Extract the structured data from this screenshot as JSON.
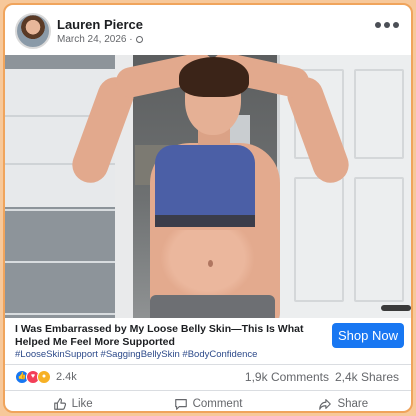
{
  "post": {
    "author_name": "Lauren Pierce",
    "date": "March 24, 2026",
    "date_separator": "·",
    "menu_icon": "more-horizontal-icon",
    "audience_icon": "globe-icon"
  },
  "ad": {
    "headline": "I Was Embarrassed by My Loose Belly Skin—This Is What Helped Me Feel More Supported",
    "hashtags": "#LooseSkinSupport #SaggingBellySkin #BodyConfidence",
    "cta_label": "Shop Now",
    "cta_color": "#1877f2"
  },
  "stats": {
    "reaction_icons": [
      "like-reaction-icon",
      "love-reaction-icon",
      "wow-reaction-icon"
    ],
    "reaction_count": "2.4k",
    "comments": "1,9k Comments",
    "shares": "2,4k Shares"
  },
  "actions": {
    "like": "Like",
    "comment": "Comment",
    "share": "Share"
  },
  "colors": {
    "frame_border": "#f0a45c",
    "background": "#f7c89a",
    "accent": "#1877f2"
  }
}
